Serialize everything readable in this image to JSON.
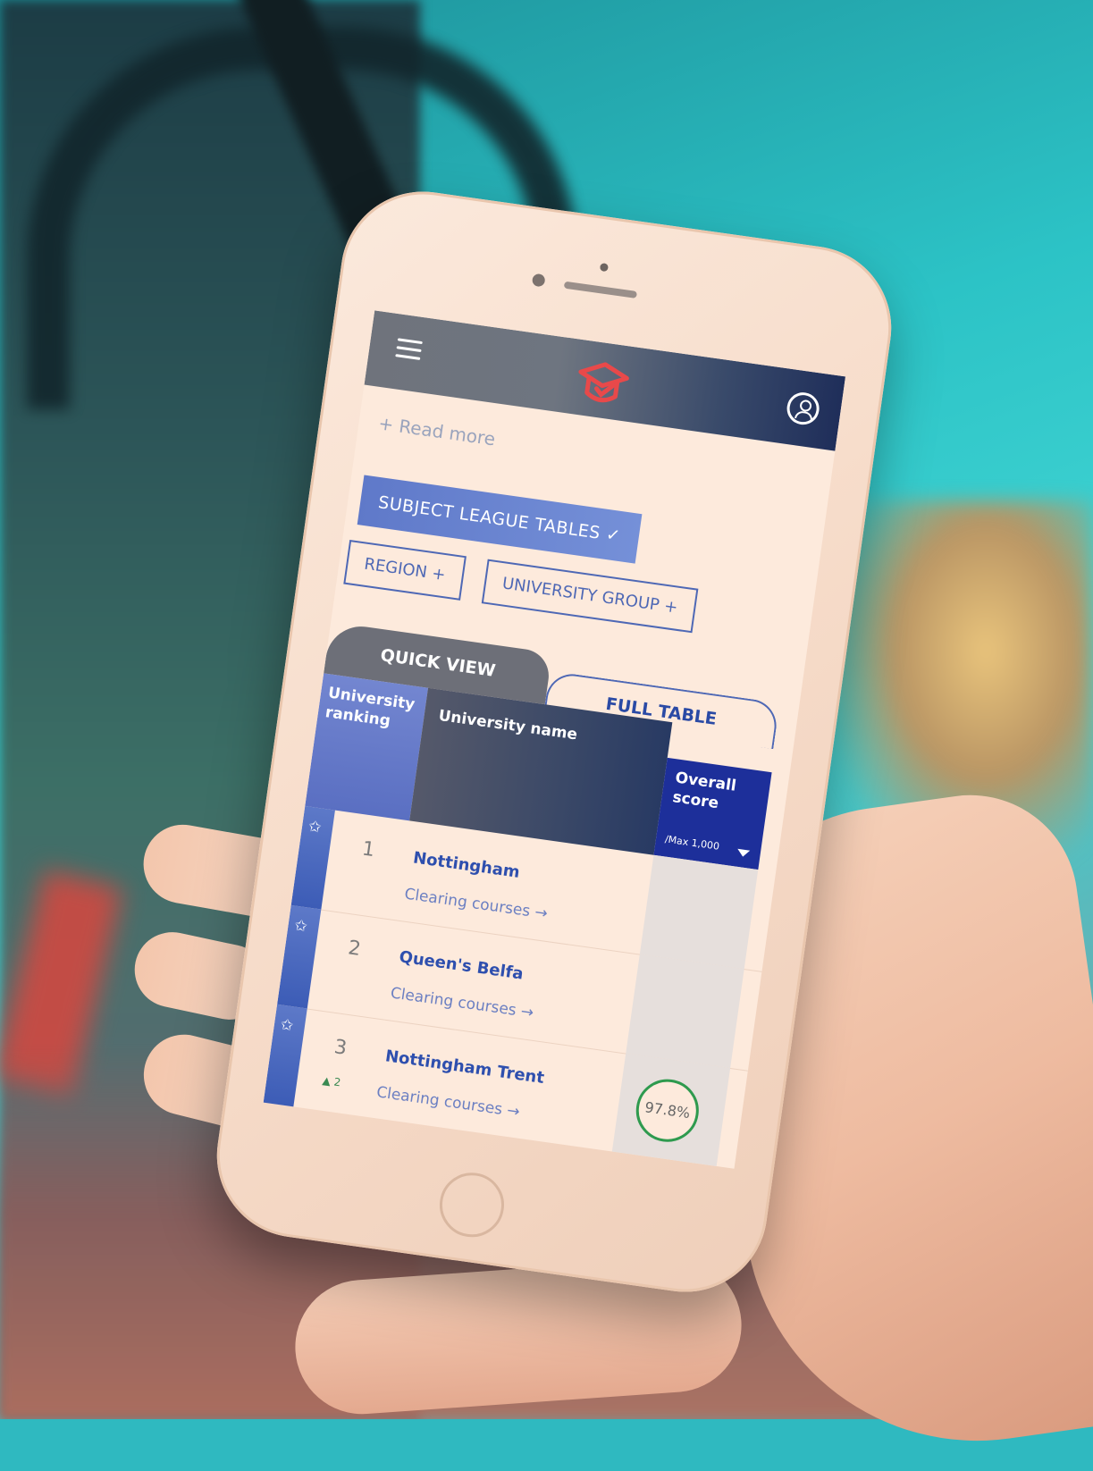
{
  "header": {
    "menu_icon": "hamburger-menu-icon",
    "logo_icon": "graduation-cap-logo-icon",
    "user_icon": "user-account-icon"
  },
  "intro": {
    "read_more": "+ Read more"
  },
  "filters": {
    "subject_league_tables": "SUBJECT LEAGUE TABLES ✓",
    "region": "REGION  +",
    "university_group": "UNIVERSITY GROUP  +"
  },
  "tabs": {
    "quick_view": "QUICK VIEW",
    "full_table": "FULL TABLE"
  },
  "table": {
    "col_ranking": "University ranking",
    "col_name": "University name",
    "col_score": "Overall score",
    "col_score_sub": "/Max 1,000",
    "rows": [
      {
        "rank": "1",
        "name": "Nottingham",
        "link": "Clearing courses  →",
        "delta": "",
        "score": ""
      },
      {
        "rank": "2",
        "name": "Queen's Belfa",
        "link": "Clearing courses  →",
        "delta": "",
        "score": ""
      },
      {
        "rank": "3",
        "name": "Nottingham Trent",
        "link": "Clearing courses  →",
        "delta": "▲ 2",
        "score": "97.8%"
      }
    ]
  },
  "colors": {
    "accent": "#4e68b5",
    "brand_logo": "#e8494a",
    "score_ring": "#2e9a4e"
  }
}
